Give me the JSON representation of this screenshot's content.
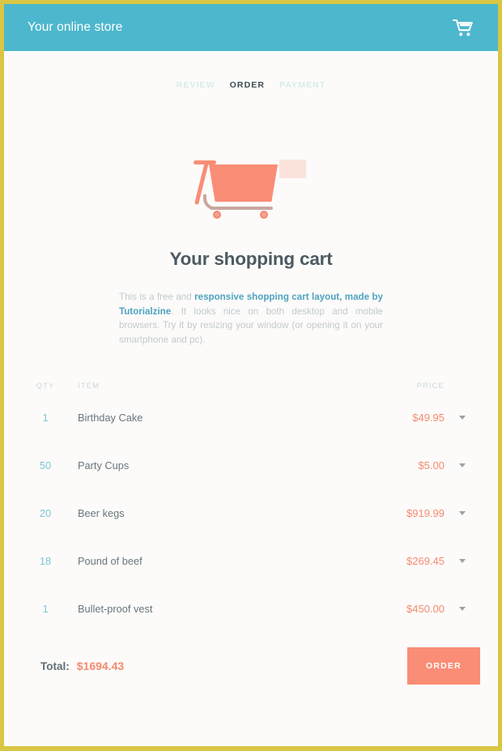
{
  "frame": {
    "border_color": "#d8c644",
    "background": "#fcfbfa"
  },
  "topbar": {
    "brand": "Your online store",
    "background": "#4cb7cd",
    "cart_icon": "shopping-cart-icon"
  },
  "steps": [
    {
      "label": "REVIEW",
      "active": false
    },
    {
      "label": "ORDER",
      "active": true
    },
    {
      "label": "PAYMENT",
      "active": false
    }
  ],
  "illustration": {
    "name": "shopping-cart-illustration",
    "cart_color": "#fa8d76",
    "box_color": "#fbe3dc",
    "bar_color": "#c9a79e"
  },
  "heading": {
    "title": "Your shopping cart"
  },
  "intro": {
    "part1": "This is a free and ",
    "highlight": "responsive shopping cart layout, made by Tutorialzine",
    "part2": ". It looks nice on both desktop and mobile browsers. Try it by resizing your window (or opening it on your smartphone and pc).",
    "highlight_color": "#4fa3c0"
  },
  "table": {
    "headers": {
      "qty": "QTY",
      "item": "ITEM",
      "price": "PRICE"
    },
    "rows": [
      {
        "qty": "1",
        "item": "Birthday Cake",
        "price": "$49.95"
      },
      {
        "qty": "50",
        "item": "Party Cups",
        "price": "$5.00"
      },
      {
        "qty": "20",
        "item": "Beer kegs",
        "price": "$919.99"
      },
      {
        "qty": "18",
        "item": "Pound of beef",
        "price": "$269.45"
      },
      {
        "qty": "1",
        "item": "Bullet-proof vest",
        "price": "$450.00"
      }
    ],
    "caret_icon": "chevron-down-icon"
  },
  "footer": {
    "total_label": "Total:",
    "total_amount": "$1694.43",
    "order_label": "ORDER",
    "order_color": "#fa8d76"
  },
  "colors": {
    "accent_blue": "#4cb7cd",
    "accent_coral": "#fa8d76",
    "qty_teal": "#7ec6d4",
    "gold_border": "#d8c644"
  }
}
